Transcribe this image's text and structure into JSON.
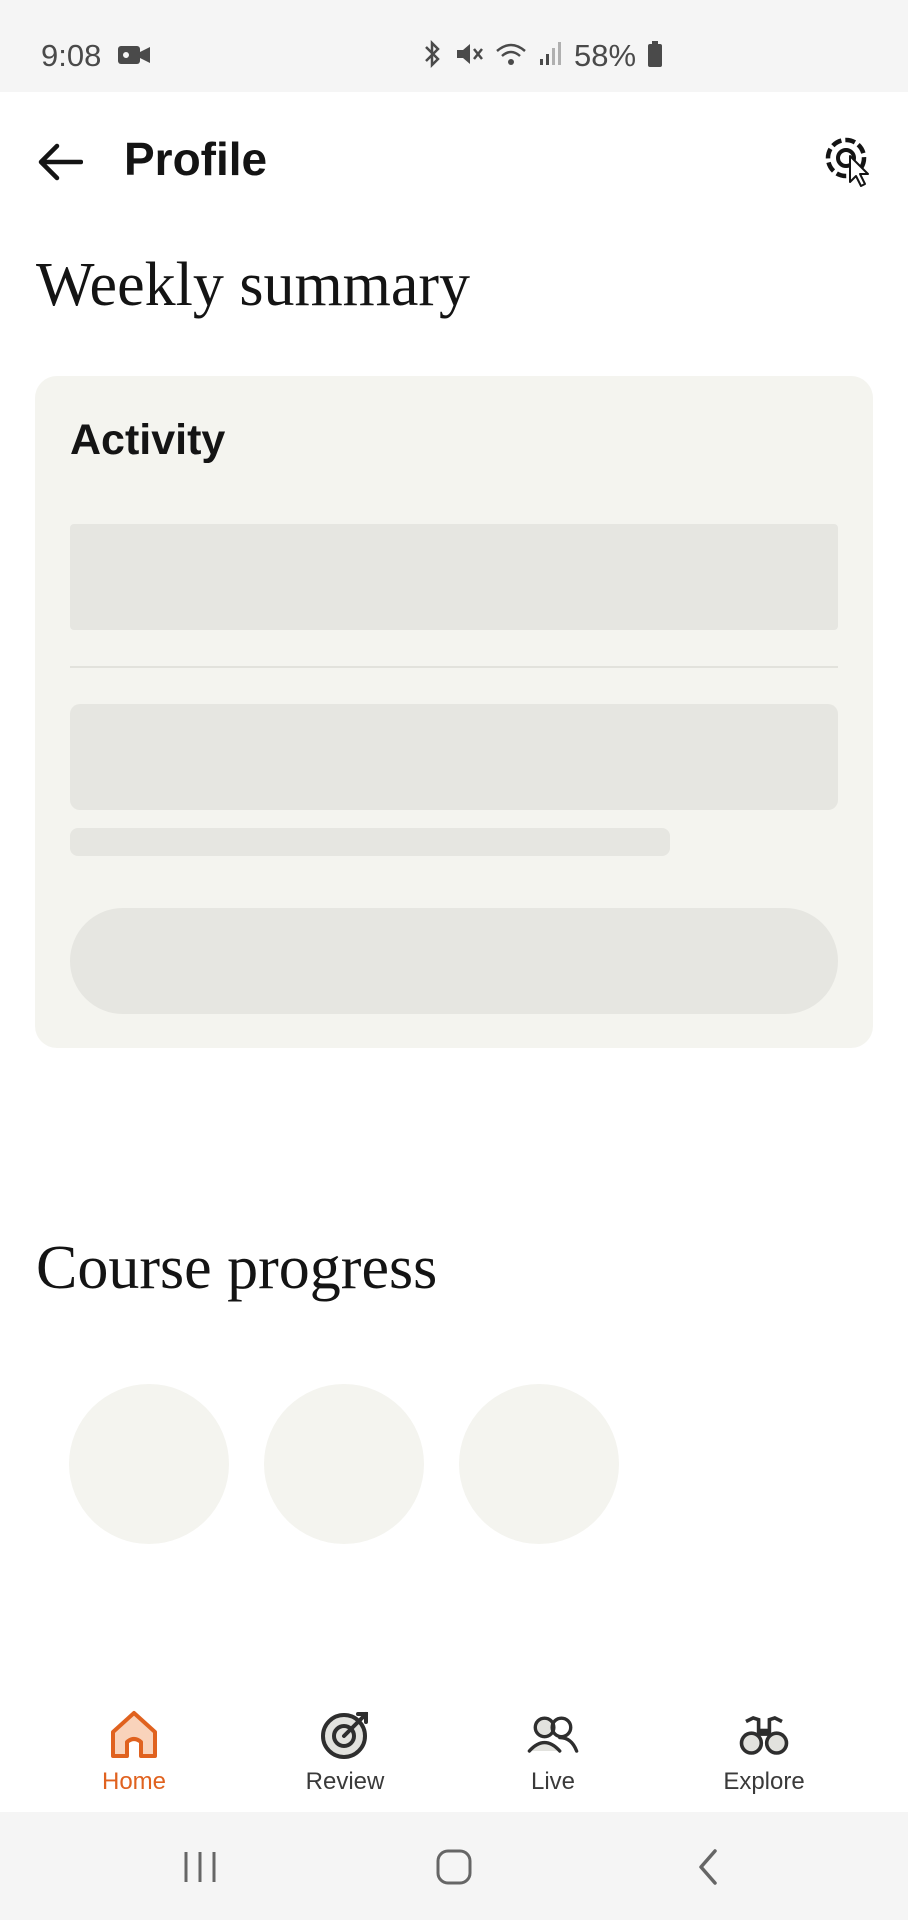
{
  "status_bar": {
    "time": "9:08",
    "battery": "58%"
  },
  "header": {
    "title": "Profile",
    "back_icon": "arrow-left-icon",
    "settings_icon": "gear-icon"
  },
  "weekly_summary": {
    "title": "Weekly summary",
    "card_title": "Activity"
  },
  "course_progress": {
    "title": "Course progress"
  },
  "bottom_nav": {
    "items": [
      {
        "label": "Home",
        "icon": "home-icon",
        "active": true
      },
      {
        "label": "Review",
        "icon": "target-icon",
        "active": false
      },
      {
        "label": "Live",
        "icon": "people-icon",
        "active": false
      },
      {
        "label": "Explore",
        "icon": "binoculars-icon",
        "active": false
      }
    ]
  },
  "colors": {
    "accent": "#e0621f",
    "card_bg": "#f4f4ef",
    "skeleton": "#e6e6e1"
  }
}
